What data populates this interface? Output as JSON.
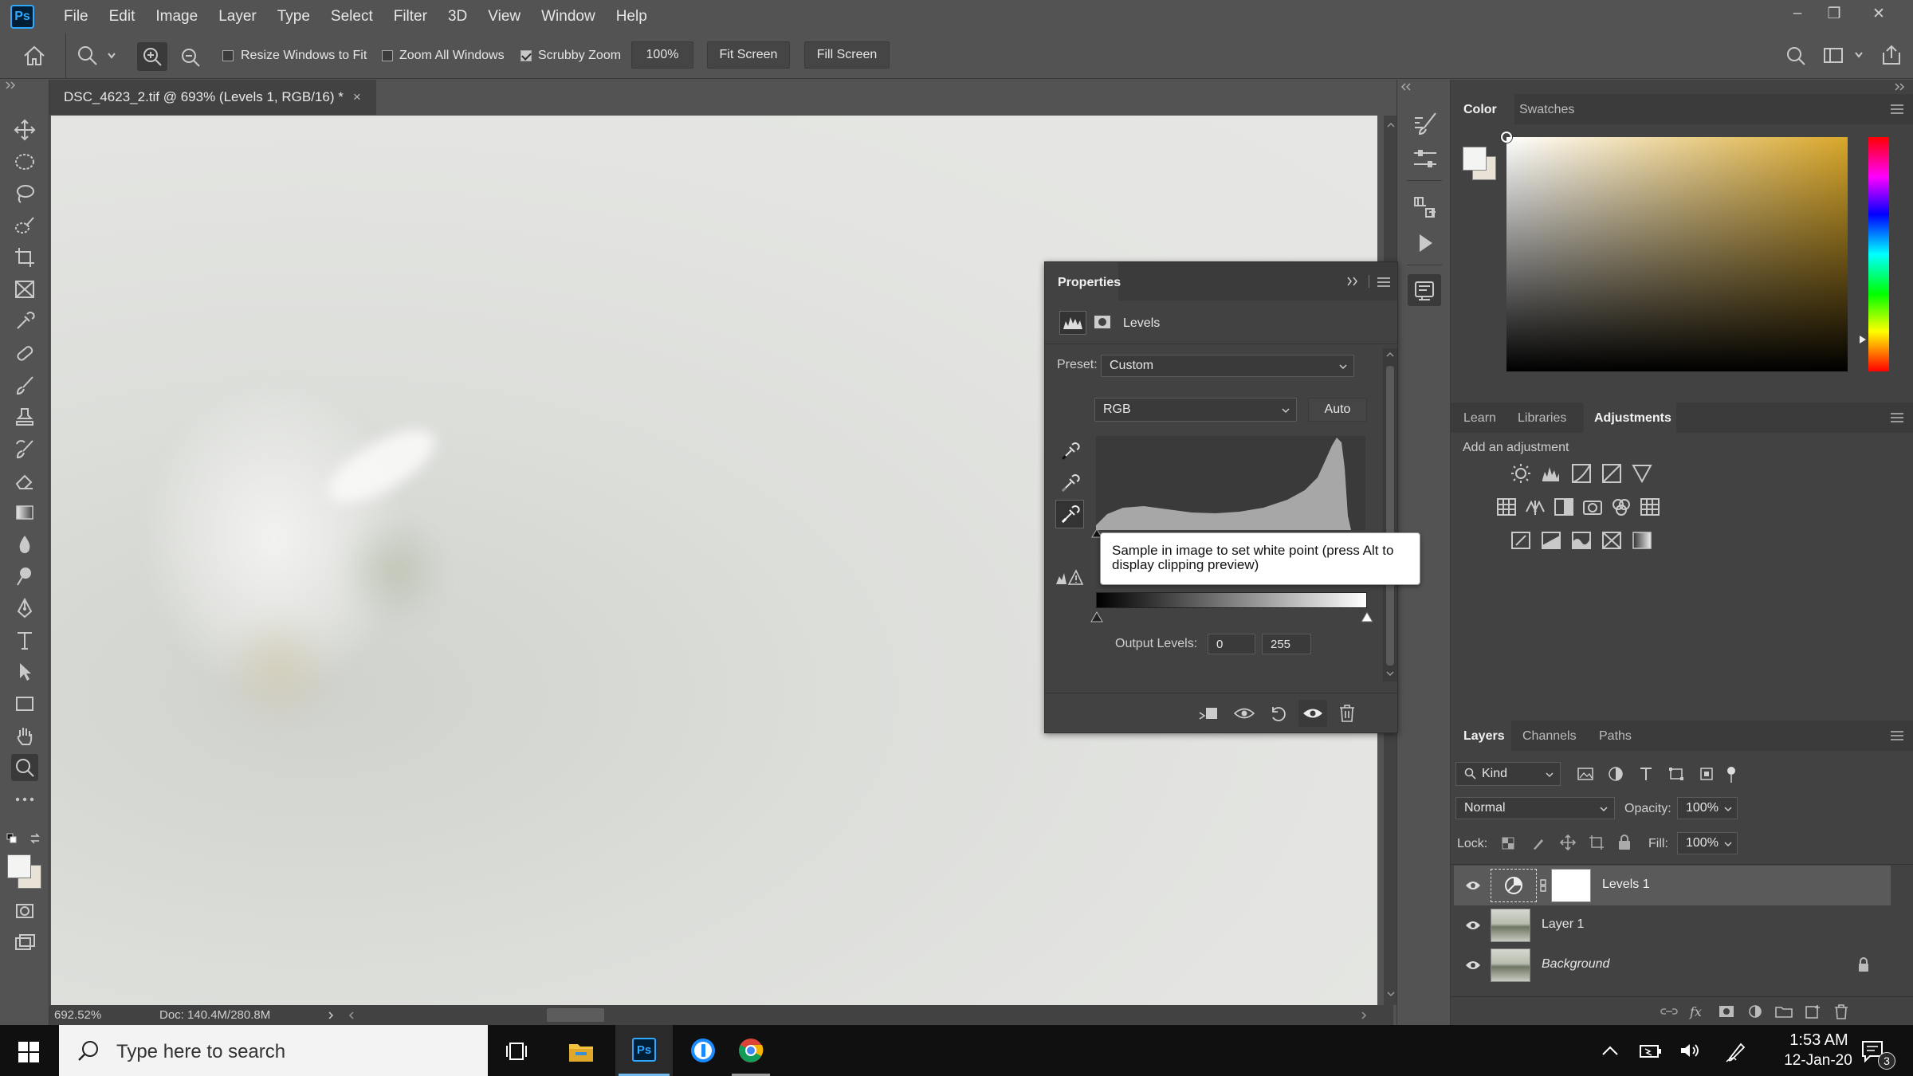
{
  "app": {
    "logo": "Ps"
  },
  "menu": [
    "File",
    "Edit",
    "Image",
    "Layer",
    "Type",
    "Select",
    "Filter",
    "3D",
    "View",
    "Window",
    "Help"
  ],
  "window_controls": {
    "minimize": "–",
    "restore": "❐",
    "close": "✕"
  },
  "options": {
    "resize_windows": "Resize Windows to Fit",
    "zoom_all": "Zoom All Windows",
    "scrubby_zoom": "Scrubby Zoom",
    "zoom_value": "100%",
    "fit_screen": "Fit Screen",
    "fill_screen": "Fill Screen"
  },
  "document": {
    "tab_title": "DSC_4623_2.tif @ 693% (Levels 1, RGB/16) *",
    "close": "×"
  },
  "status": {
    "zoom": "692.52%",
    "doc": "Doc: 140.4M/280.8M"
  },
  "properties": {
    "title": "Properties",
    "adjustment": "Levels",
    "preset_label": "Preset:",
    "preset_value": "Custom",
    "channel": "RGB",
    "auto": "Auto",
    "tooltip": "Sample in image to set white point (press Alt to display clipping preview)",
    "output_label": "Output Levels:",
    "output_low": "0",
    "output_high": "255"
  },
  "color_panel": {
    "tabs": [
      "Color",
      "Swatches"
    ]
  },
  "adjustments_panel": {
    "tabs": [
      "Learn",
      "Libraries",
      "Adjustments"
    ],
    "hint": "Add an adjustment"
  },
  "layers_panel": {
    "tabs": [
      "Layers",
      "Channels",
      "Paths"
    ],
    "filter_kind": "Kind",
    "blend_mode": "Normal",
    "opacity_label": "Opacity:",
    "opacity_value": "100%",
    "lock_label": "Lock:",
    "fill_label": "Fill:",
    "fill_value": "100%",
    "layers": [
      {
        "name": "Levels 1"
      },
      {
        "name": "Layer 1"
      },
      {
        "name": "Background"
      }
    ]
  },
  "taskbar": {
    "search_placeholder": "Type here to search",
    "time": "1:53 AM",
    "date": "12-Jan-20",
    "notifications": "3"
  },
  "colors": {
    "accent": "#31a8ff",
    "panel": "#424242",
    "chrome": "#535353"
  }
}
